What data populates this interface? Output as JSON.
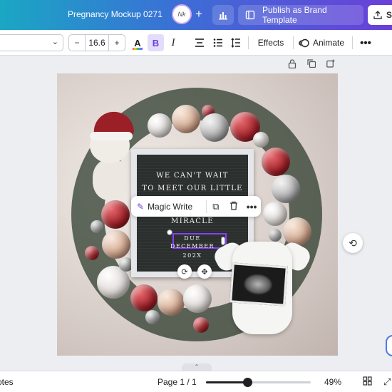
{
  "header": {
    "doc_title": "Pregnancy Mockup 0271",
    "avatar_text": "Nk",
    "add_symbol": "+",
    "insights_icon": "bar-chart-icon",
    "publish_label": "Publish as Brand Template",
    "share_label": "S"
  },
  "toolbar": {
    "font_size": "16.6",
    "minus": "−",
    "plus": "+",
    "color_glyph": "A",
    "bold": "B",
    "italic": "I",
    "align_glyph": "≡",
    "list_glyph": "☰",
    "spacing_glyph": "↕",
    "effects_label": "Effects",
    "animate_label": "Animate",
    "more_glyph": "•••"
  },
  "canvas_icons": [
    "lock-icon",
    "duplicate-icon",
    "add-page-icon"
  ],
  "design": {
    "board_lines": [
      "WE CAN'T WAIT",
      "TO MEET OUR LITTLE",
      "MIRACLE"
    ],
    "due_lines": [
      "DUE",
      "DECEMBER",
      "202X"
    ]
  },
  "magic_bar": {
    "magic_write_label": "Magic Write",
    "magic_glyph": "✎",
    "copy_glyph": "⧉",
    "delete_glyph": "🗑",
    "more_glyph": "•••"
  },
  "status": {
    "notes_label": "otes",
    "page_label": "Page 1 / 1",
    "zoom_label": "49%",
    "zoom_fraction": 0.4
  },
  "colors": {
    "accent": "#8b3dff",
    "gradient_start": "#1aa7c4",
    "gradient_end": "#6a40d8"
  }
}
